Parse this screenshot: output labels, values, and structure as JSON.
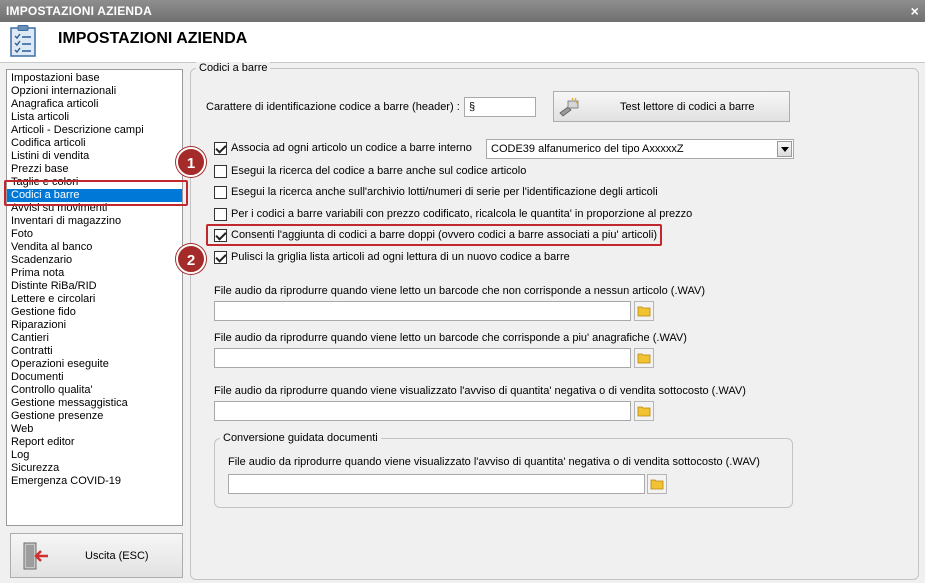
{
  "window": {
    "title": "IMPOSTAZIONI AZIENDA",
    "close_glyph": "×"
  },
  "header": {
    "title": "IMPOSTAZIONI AZIENDA",
    "icon": "clipboard-checklist-icon"
  },
  "sidebar": {
    "items": [
      "Impostazioni base",
      "Opzioni internazionali",
      "Anagrafica articoli",
      "Lista articoli",
      "Articoli - Descrizione campi",
      "Codifica articoli",
      "Listini di vendita",
      "Prezzi base",
      "Taglie e colori",
      "Codici a barre",
      "Avvisi su movimenti",
      "Inventari di magazzino",
      "Foto",
      "Vendita al banco",
      "Scadenzario",
      "Prima nota",
      "Distinte RiBa/RID",
      "Lettere e circolari",
      "Gestione fido",
      "Riparazioni",
      "Cantieri",
      "Contratti",
      "Operazioni eseguite",
      "Documenti",
      "Controllo qualita'",
      "Gestione messaggistica",
      "Gestione presenze",
      "Web",
      "Report editor",
      "Log",
      "Sicurezza",
      "Emergenza COVID-19"
    ],
    "selected_index": 9
  },
  "exit_button": {
    "label": "Uscita (ESC)",
    "icon": "exit-door-icon"
  },
  "barcodes": {
    "group_label": "Codici a barre",
    "header_char_label": "Carattere di identificazione codice a barre (header) :",
    "header_char_value": "§",
    "test_button_label": "Test lettore di codici a barre",
    "options": [
      {
        "label": "Associa ad ogni articolo un codice a barre interno",
        "checked": true
      },
      {
        "label": "Esegui la ricerca del codice a barre anche sul codice articolo",
        "checked": false
      },
      {
        "label": "Esegui la ricerca anche sull'archivio lotti/numeri di serie per l'identificazione degli articoli",
        "checked": false
      },
      {
        "label": "Per i codici a barre variabili con prezzo codificato, ricalcola le quantita' in proporzione al prezzo",
        "checked": false
      },
      {
        "label": "Consenti l'aggiunta di codici a barre doppi (ovvero codici a barre associati a piu' articoli)",
        "checked": true
      },
      {
        "label": "Pulisci la griglia lista articoli ad ogni lettura di un nuovo codice a barre",
        "checked": true
      }
    ],
    "barcode_type_value": "CODE39 alfanumerico del tipo AxxxxxZ",
    "audio_not_found_label": "File audio da riprodurre quando viene letto un barcode che non corrisponde a nessun articolo (.WAV)",
    "audio_not_found_value": "",
    "audio_multiple_label": "File audio da riprodurre quando viene letto un barcode che corrisponde a piu' anagrafiche (.WAV)",
    "audio_multiple_value": "",
    "audio_negative_label": "File audio da riprodurre quando viene visualizzato l'avviso di quantita' negativa o di vendita sottocosto (.WAV)",
    "audio_negative_value": "",
    "conversion_group_label": "Conversione guidata documenti",
    "conversion_audio_label": "File audio da riprodurre quando viene visualizzato l'avviso di quantita' negativa o di vendita sottocosto (.WAV)",
    "conversion_audio_value": ""
  },
  "callouts": {
    "one": "1",
    "two": "2",
    "color": "#a52a2a"
  }
}
